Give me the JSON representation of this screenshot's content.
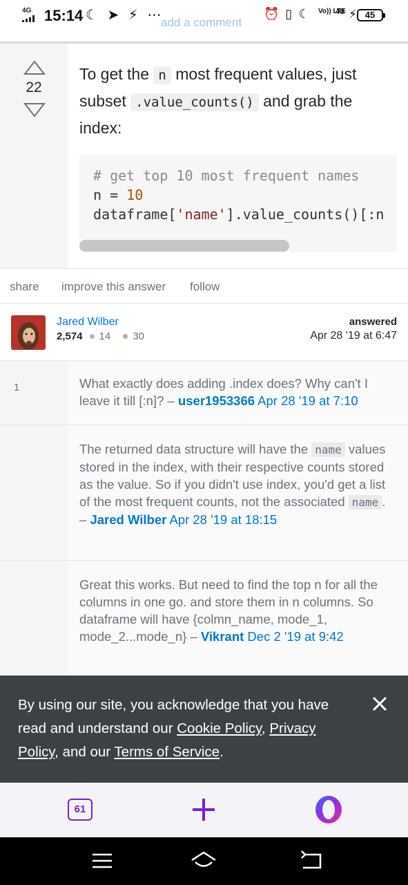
{
  "status_bar": {
    "network": "4G",
    "time": "15:14",
    "left_icons": "☾ ➤ ⚡ ⋯",
    "overlay_text": "add a comment",
    "right_icons": "⏰ ▯ ☾",
    "volte": "Vo)) LTE",
    "network_right": "4G",
    "battery": "45"
  },
  "answer": {
    "vote_count": "22",
    "text_parts": [
      "To get the ",
      "n",
      " most frequent values, just subset ",
      ".value_counts()",
      " and grab the index:"
    ],
    "code_lines": [
      {
        "comment": "# get top 10 most frequent names"
      },
      {
        "prefix": "n = ",
        "num": "10"
      },
      {
        "prefix": "dataframe[",
        "str": "'name'",
        "suffix": "].value_counts()[:n"
      }
    ]
  },
  "actions": {
    "share": "share",
    "improve": "improve this answer",
    "follow": "follow"
  },
  "user": {
    "name": "Jared Wilber",
    "reputation": "2,574",
    "silver_badges": "14",
    "bronze_badges": "30",
    "answered_label": "answered",
    "answered_date": "Apr 28 '19 at 6:47"
  },
  "comments": [
    {
      "score": "1",
      "text_a": "What exactly does adding .index does? Why can't I leave it till [:n]? – ",
      "user": "user1953366",
      "date": "Apr 28 '19 at 7:10"
    },
    {
      "score": "",
      "text_a": "The returned data structure will have the ",
      "code_a": "name",
      "text_b": " values stored in the index, with their respective counts stored as the value. So if you didn't use index, you'd get a list of the most frequent counts, not the associated ",
      "code_b": "name",
      "text_c": ". – ",
      "user": "Jared Wilber",
      "date": "Apr 28 '19 at 18:15"
    },
    {
      "score": "",
      "text_a": "Great this works. But need to find the top n for all the columns in one go. and store them in n columns. So dataframe will have {colmn_name, mode_1, mode_2...mode_n} – ",
      "user": "Vikrant",
      "date": "Dec 2 '19 at 9:42"
    }
  ],
  "cookie_banner": {
    "text_a": "By using our site, you acknowledge that you have read and understand our ",
    "cookie_policy": "Cookie Policy",
    "sep": ", ",
    "privacy_policy": "Privacy Policy",
    "text_b": ", and our ",
    "terms": "Terms of Service",
    "text_c": "."
  },
  "browser_bar": {
    "tabs_count": "61"
  },
  "colors": {
    "link": "#0077cc",
    "opera": "#7a1fd1",
    "banner": "#3c4145"
  }
}
